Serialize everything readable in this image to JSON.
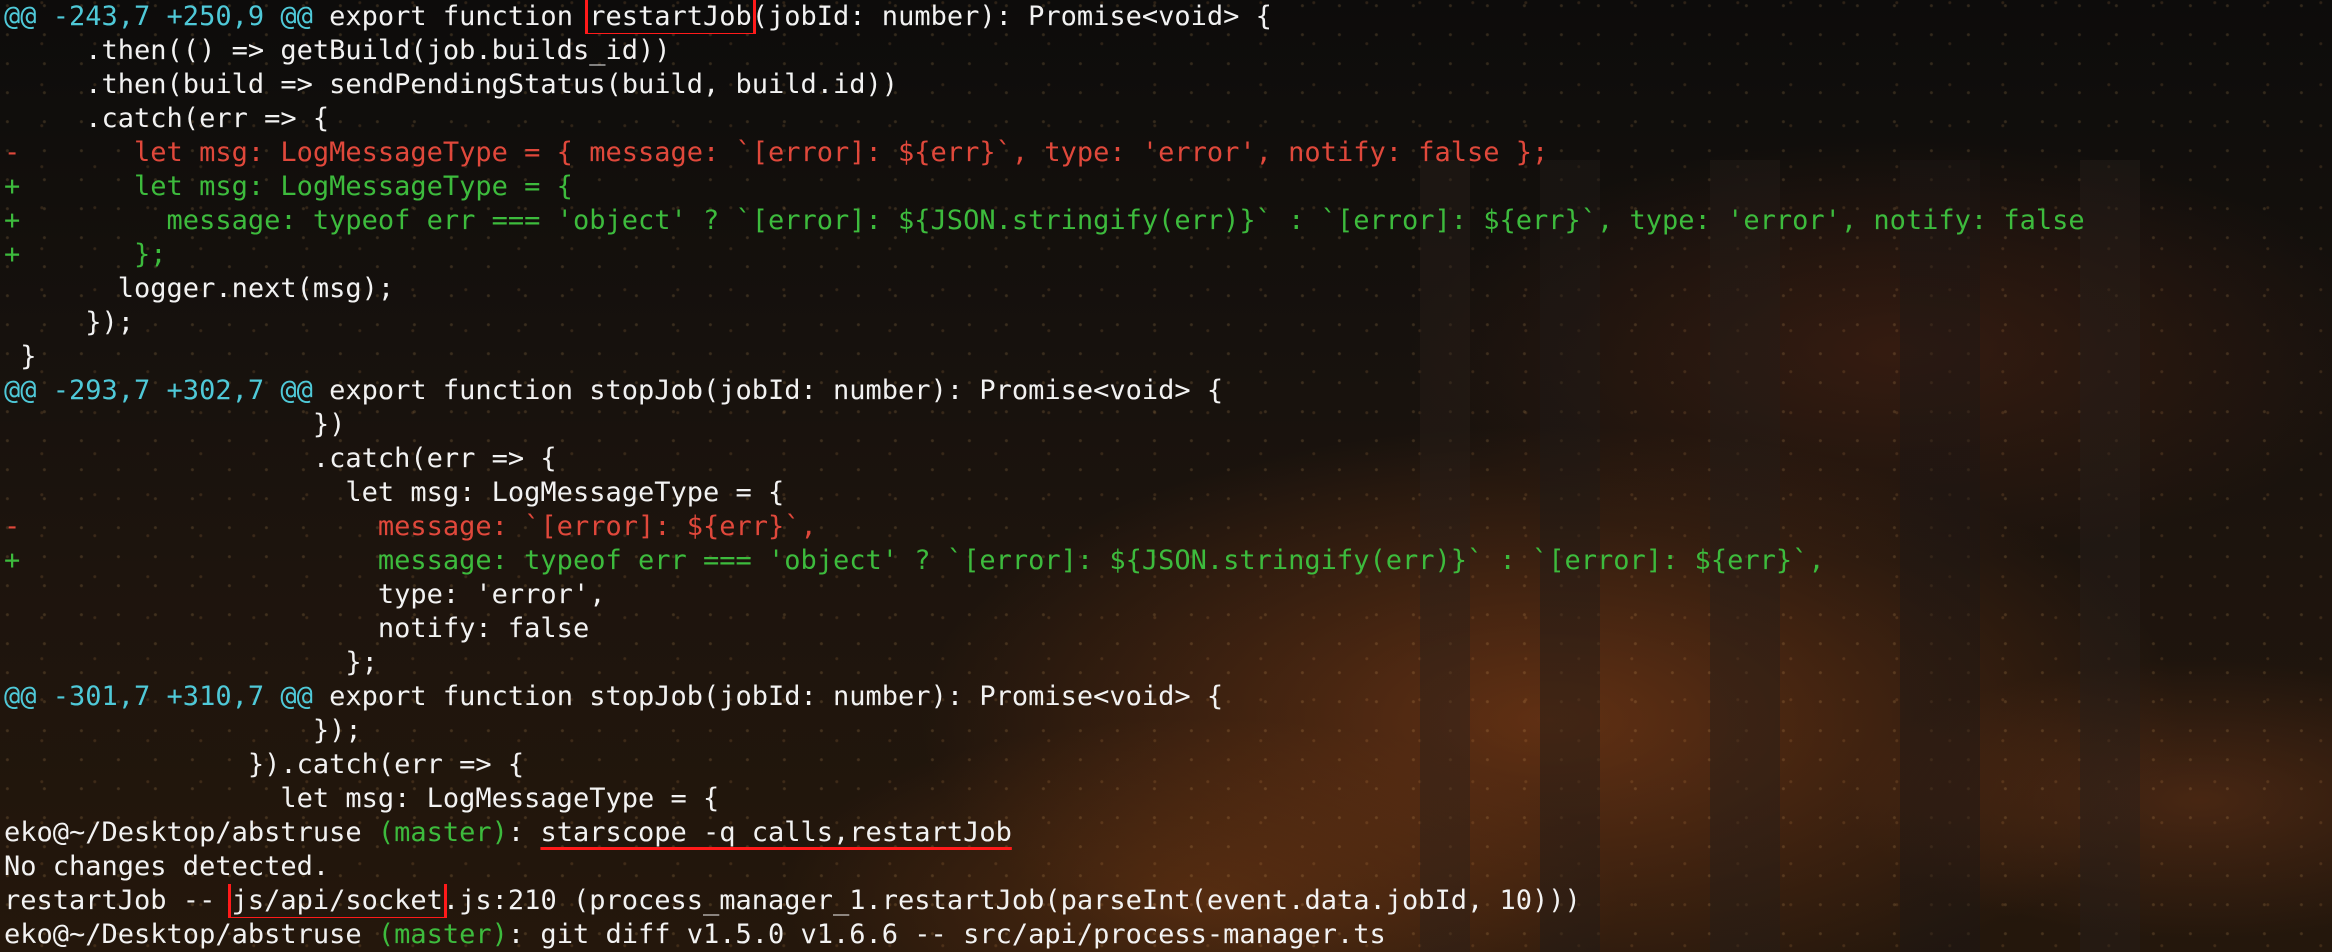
{
  "terminal": {
    "lines": {
      "l1_hunk": "@@ -243,7 +250,9 @@",
      "l1_pre": " export function ",
      "l1_func": "restartJob",
      "l1_post": "(jobId: number): Promise<void> {",
      "l2": "     .then(() => getBuild(job.builds_id))",
      "l3": "     .then(build => sendPendingStatus(build, build.id))",
      "l4": "     .catch(err => {",
      "l5": "-       let msg: LogMessageType = { message: `[error]: ${err}`, type: 'error', notify: false };",
      "l6": "+       let msg: LogMessageType = {",
      "l7": "+         message: typeof err === 'object' ? `[error]: ${JSON.stringify(err)}` : `[error]: ${err}`, type: 'error', notify: false",
      "l8": "+       };",
      "l9": "       logger.next(msg);",
      "l10": "     });",
      "l11": " }",
      "l12_hunk": "@@ -293,7 +302,7 @@",
      "l12_rest": " export function stopJob(jobId: number): Promise<void> {",
      "l13": "                   })",
      "l14": "                   .catch(err => {",
      "l15": "                     let msg: LogMessageType = {",
      "l16": "-                      message: `[error]: ${err}`,",
      "l17": "+                      message: typeof err === 'object' ? `[error]: ${JSON.stringify(err)}` : `[error]: ${err}`,",
      "l18": "                       type: 'error',",
      "l19": "                       notify: false",
      "l20": "                     };",
      "l21_hunk": "@@ -301,7 +310,7 @@",
      "l21_rest": " export function stopJob(jobId: number): Promise<void> {",
      "l22": "                   });",
      "l23": "               }).catch(err => {",
      "l24": "                 let msg: LogMessageType = {",
      "l25_prompt": "eko@~/Desktop/abstruse ",
      "l25_branch": "(master)",
      "l25_colon": ": ",
      "l25_cmd": "starscope -q calls,restartJob",
      "l26": "No changes detected.",
      "l27_pre": "restartJob -- ",
      "l27_path": "js/api/socket",
      "l27_post": ".js:210 (process_manager_1.restartJob(parseInt(event.data.jobId, 10)))",
      "l28_prompt": "eko@~/Desktop/abstruse ",
      "l28_branch": "(master)",
      "l28_cmd": ": git diff v1.5.0 v1.6.6 -- src/api/process-manager.ts"
    }
  },
  "colors": {
    "hunk_header": "#4fc9d8",
    "removed": "#e0483b",
    "added": "#3dbb3d",
    "text": "#f2f2f2",
    "highlight": "#ff1a1a"
  }
}
